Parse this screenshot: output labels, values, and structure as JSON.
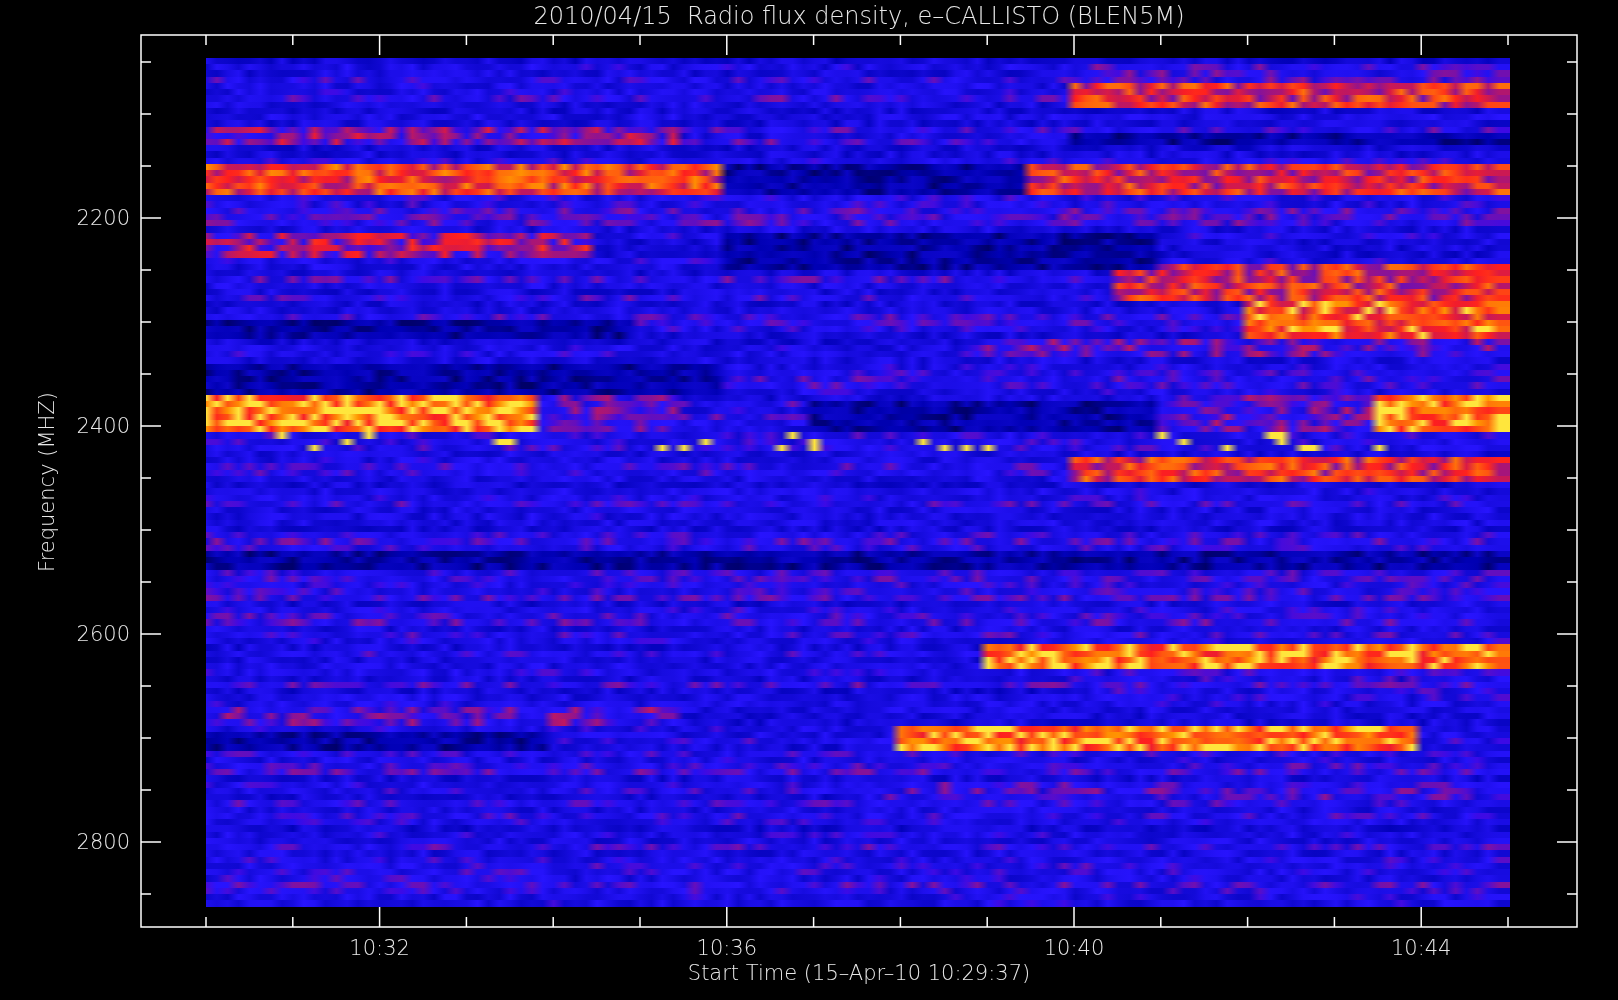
{
  "chart": {
    "title": "2010/04/15  Radio flux density, e–CALLISTO (BLEN5M)",
    "ylabel": "Frequency (MHZ)",
    "xlabel": "Start Time (15–Apr–10 10:29:37)",
    "yticks": [
      "2200",
      "2400",
      "2600",
      "2800"
    ],
    "xticks": [
      "10:32",
      "10:36",
      "10:40",
      "10:44"
    ]
  }
}
